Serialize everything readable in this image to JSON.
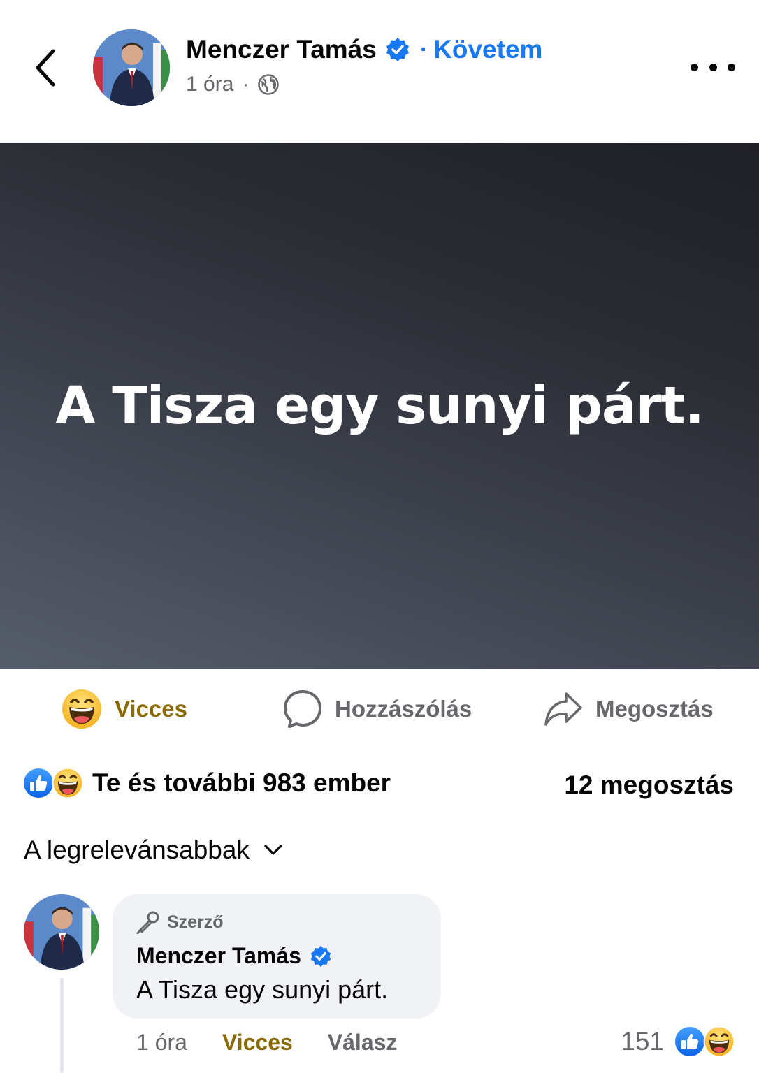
{
  "header": {
    "author_name": "Menczer Tamás",
    "follow_separator": "·",
    "follow_label": "Követem",
    "time": "1 óra",
    "meta_separator": "·"
  },
  "post": {
    "text": "A Tisza egy sunyi párt."
  },
  "actions": {
    "reaction_label": "Vicces",
    "comment_label": "Hozzászólás",
    "share_label": "Megosztás"
  },
  "summary": {
    "reactions_text": "Te és további 983 ember",
    "shares_text": "12 megosztás"
  },
  "comments": {
    "sort_label": "A legrelevánsabbak",
    "items": [
      {
        "badge": "Szerző",
        "author": "Menczer Tamás",
        "text": "A Tisza egy sunyi párt.",
        "time": "1 óra",
        "reaction_label": "Vicces",
        "reply_label": "Válasz",
        "reaction_count": "151"
      }
    ]
  },
  "colors": {
    "accent": "#1877f2",
    "haha_text": "#8a6a05",
    "muted": "#65676b"
  },
  "icons": [
    "back-arrow-icon",
    "verified-icon",
    "globe-icon",
    "more-icon",
    "haha-emoji-icon",
    "comment-icon",
    "share-icon",
    "like-icon",
    "chevron-down-icon",
    "microphone-icon"
  ]
}
